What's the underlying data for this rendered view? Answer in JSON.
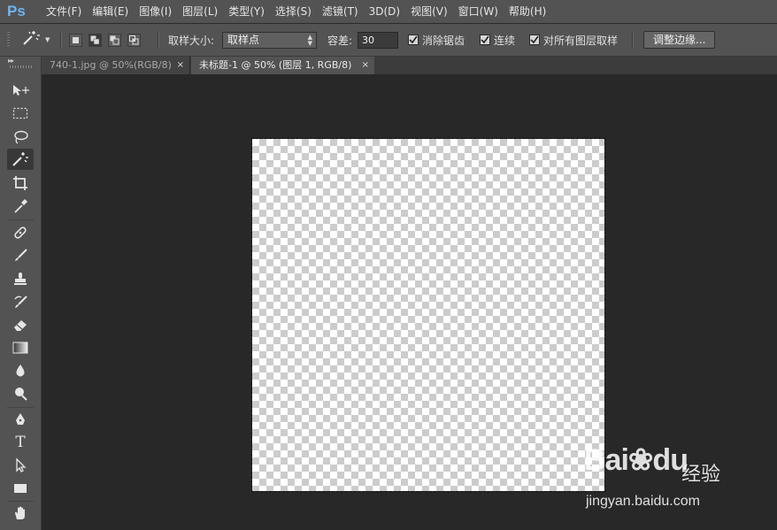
{
  "app": {
    "logo": "Ps"
  },
  "menu": [
    "文件(F)",
    "编辑(E)",
    "图像(I)",
    "图层(L)",
    "类型(Y)",
    "选择(S)",
    "滤镜(T)",
    "3D(D)",
    "视图(V)",
    "窗口(W)",
    "帮助(H)"
  ],
  "options": {
    "tool_icon": "magic-wand-icon",
    "sample_size_label": "取样大小:",
    "sample_size_value": "取样点",
    "tolerance_label": "容差:",
    "tolerance_value": "30",
    "anti_alias_label": "消除锯齿",
    "anti_alias_checked": true,
    "contiguous_label": "连续",
    "contiguous_checked": true,
    "sample_all_layers_label": "对所有图层取样",
    "sample_all_layers_checked": true,
    "refine_edge_button": "调整边缘..."
  },
  "tabs": [
    {
      "label": "740-1.jpg @ 50%(RGB/8)",
      "active": false,
      "close": "×"
    },
    {
      "label": "未标题-1 @ 50% (图层 1, RGB/8)",
      "active": true,
      "close": "×"
    }
  ],
  "toolbox": {
    "collapse_glyph": "▸▸",
    "tools": [
      "move-icon",
      "rectangular-marquee-icon",
      "lasso-icon",
      "magic-wand-icon",
      "crop-icon",
      "eyedropper-icon",
      "spot-healing-icon",
      "brush-icon",
      "clone-stamp-icon",
      "history-brush-icon",
      "eraser-icon",
      "gradient-icon",
      "blur-icon",
      "dodge-icon",
      "pen-icon",
      "type-icon",
      "path-selection-icon",
      "rectangle-shape-icon",
      "hand-icon"
    ],
    "active_tool": "magic-wand-icon",
    "type_tool_glyph": "T"
  },
  "watermark": {
    "logo_text": "Bai",
    "logo_suffix": "du",
    "jingyan": "经验",
    "url": "jingyan.baidu.com"
  },
  "colors": {
    "ui_bg": "#535353",
    "workspace": "#282828",
    "ps_blue": "#6fb4f0"
  }
}
